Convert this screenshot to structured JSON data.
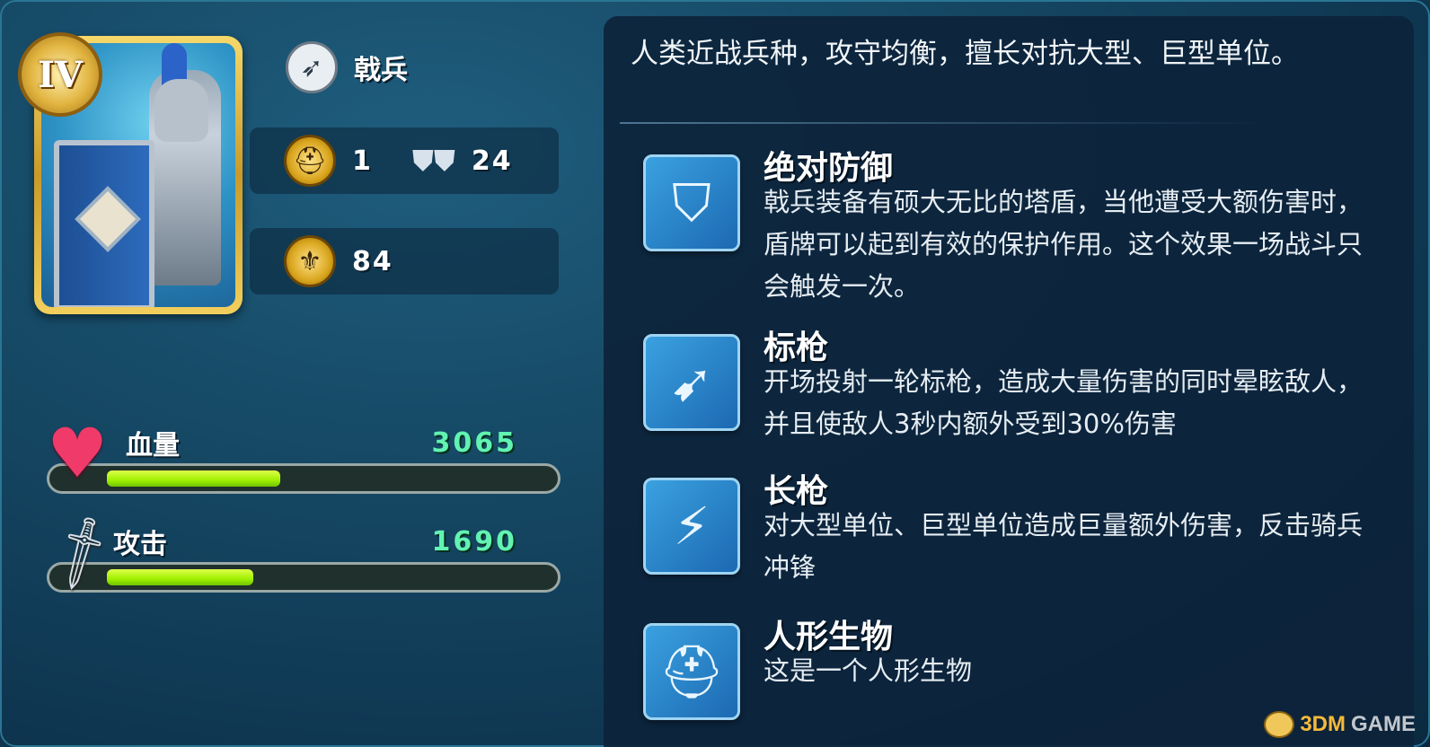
{
  "unit": {
    "rank": "IV",
    "name": "戟兵",
    "type_icon": "spear-icon",
    "level_value": "1",
    "troops_value": "24",
    "power_value": "84"
  },
  "stats": {
    "hp": {
      "label": "血量",
      "value": "3065",
      "fill": 0.39
    },
    "atk": {
      "label": "攻击",
      "value": "1690",
      "fill": 0.33
    }
  },
  "description": "人类近战兵种，攻守均衡，擅长对抗大型、巨型单位。",
  "skills": [
    {
      "title": "绝对防御",
      "desc": "戟兵装备有硕大无比的塔盾，当他遭受大额伤害时，盾牌可以起到有效的保护作用。这个效果一场战斗只会触发一次。",
      "icon": "shield-icon"
    },
    {
      "title": "标枪",
      "desc": "开场投射一轮标枪，造成大量伤害的同时晕眩敌人，并且使敌人3秒内额外受到30%伤害",
      "icon": "javelin-icon"
    },
    {
      "title": "长枪",
      "desc": "对大型单位、巨型单位造成巨量额外伤害，反击骑兵冲锋",
      "icon": "lance-icon"
    },
    {
      "title": "人形生物",
      "desc": "这是一个人形生物",
      "icon": "helmet-icon"
    }
  ],
  "watermark": {
    "brand_3d": "3DM",
    "brand_game": "GAME"
  },
  "colors": {
    "hp_value": "#62f3b2",
    "bar_fill": "#9ff000",
    "gold": "#d9a51d"
  }
}
